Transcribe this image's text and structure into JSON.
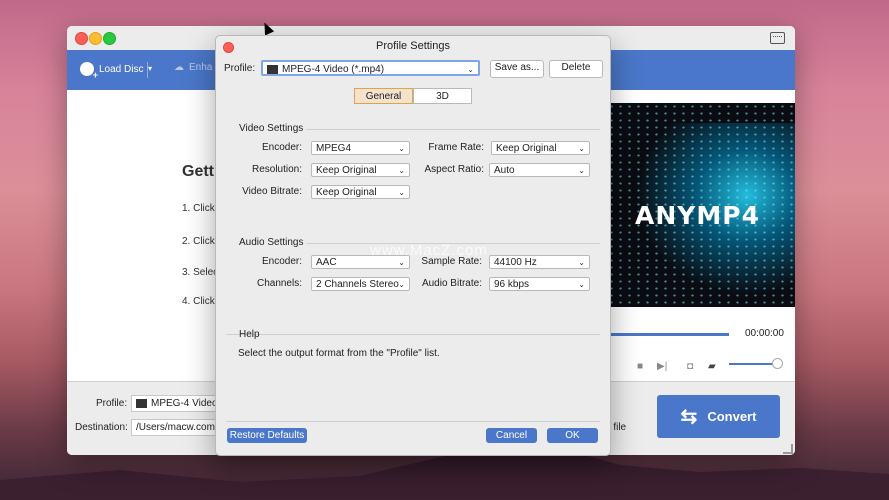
{
  "main_window": {
    "toolbar": {
      "load_disc": "Load Disc",
      "enhance": "Enha"
    },
    "getting_started": {
      "title": "Getti",
      "steps": [
        "1. Click",
        "2. Click",
        "3. Selec",
        "4. Click"
      ]
    },
    "preview": {
      "brand": "ANYMP4",
      "time": "00:00:00"
    },
    "bottom": {
      "profile_label": "Profile:",
      "profile_value": "MPEG-4 Video",
      "destination_label": "Destination:",
      "destination_value": "/Users/macw.com/D",
      "file_fragment": "e file",
      "convert_label": "Convert"
    }
  },
  "dialog": {
    "title": "Profile Settings",
    "profile_label": "Profile:",
    "profile_value": "MPEG-4 Video (*.mp4)",
    "save_as": "Save as...",
    "delete": "Delete",
    "tabs": [
      {
        "label": "General",
        "active": true
      },
      {
        "label": "3D",
        "active": false
      }
    ],
    "video_settings": {
      "heading": "Video Settings",
      "encoder_label": "Encoder:",
      "encoder_value": "MPEG4",
      "frame_rate_label": "Frame Rate:",
      "frame_rate_value": "Keep Original",
      "resolution_label": "Resolution:",
      "resolution_value": "Keep Original",
      "aspect_ratio_label": "Aspect Ratio:",
      "aspect_ratio_value": "Auto",
      "bitrate_label": "Video Bitrate:",
      "bitrate_value": "Keep Original"
    },
    "audio_settings": {
      "heading": "Audio Settings",
      "encoder_label": "Encoder:",
      "encoder_value": "AAC",
      "sample_rate_label": "Sample Rate:",
      "sample_rate_value": "44100 Hz",
      "channels_label": "Channels:",
      "channels_value": "2 Channels Stereo",
      "bitrate_label": "Audio Bitrate:",
      "bitrate_value": "96 kbps"
    },
    "help": {
      "heading": "Help",
      "text": "Select the output format from the \"Profile\" list."
    },
    "restore_defaults": "Restore Defaults",
    "cancel": "Cancel",
    "ok": "OK"
  },
  "watermark": "www.MacZ.com",
  "colors": {
    "accent": "#4a77c9",
    "tab_active_border": "#e6a050",
    "close_red": "#fe5f57"
  }
}
